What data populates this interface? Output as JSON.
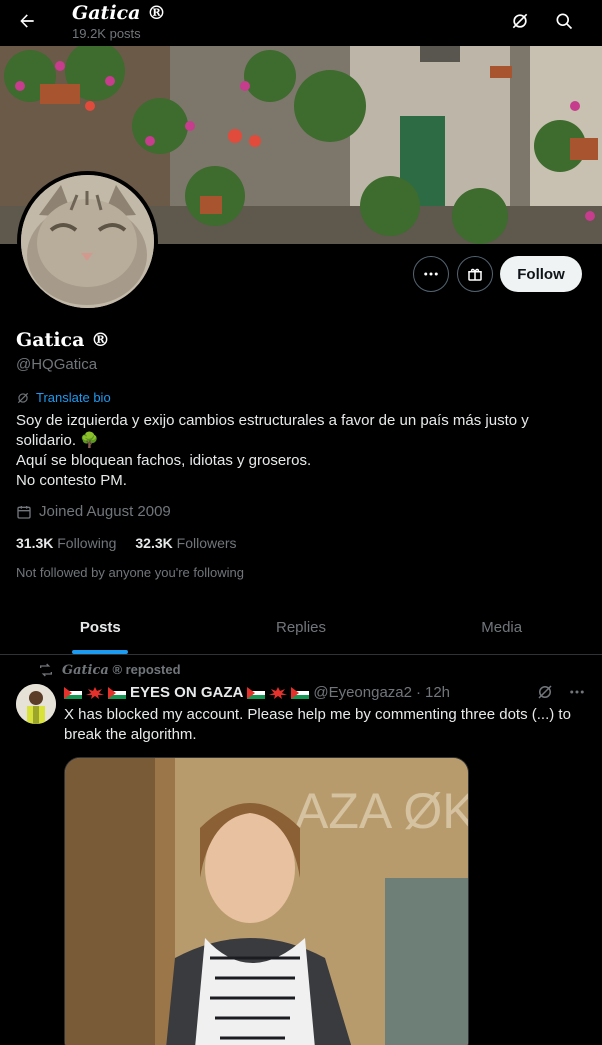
{
  "header": {
    "name": "Gatica ®",
    "post_count": "19.2K posts"
  },
  "profile": {
    "display_name": "Gatica ®",
    "handle": "@HQGatica",
    "translate_label": "Translate bio",
    "bio": "Soy  de izquierda y exijo cambios estructurales a favor de un país más justo y solidario. 🌳\nAquí se bloquean fachos, idiotas y groseros.\nNo contesto PM.",
    "joined": "Joined August 2009",
    "following_count": "31.3K",
    "following_label": "Following",
    "followers_count": "32.3K",
    "followers_label": "Followers",
    "not_followed": "Not followed by anyone you're following",
    "follow_label": "Follow"
  },
  "tabs": [
    {
      "label": "Posts",
      "active": true
    },
    {
      "label": "Replies",
      "active": false
    },
    {
      "label": "Media",
      "active": false
    }
  ],
  "post": {
    "repost_name": "Gatica",
    "repost_suffix": "® reposted",
    "author_name": "EYES ON GAZA",
    "author_handle": "@Eyeongaza2",
    "time": "12h",
    "text": "X has blocked my account. Please help me by commenting three dots (...) to break the algorithm.",
    "media_text": "AZA ØKKE"
  },
  "icons": {
    "back": "back-arrow-icon",
    "grok": "grok-icon",
    "search": "search-icon",
    "more": "more-dots-icon",
    "subscribe": "subscribe-gift-icon",
    "calendar": "calendar-icon",
    "repost": "repost-icon"
  },
  "colors": {
    "accent": "#1d9bf0",
    "background": "#000000",
    "muted": "#71767b"
  }
}
